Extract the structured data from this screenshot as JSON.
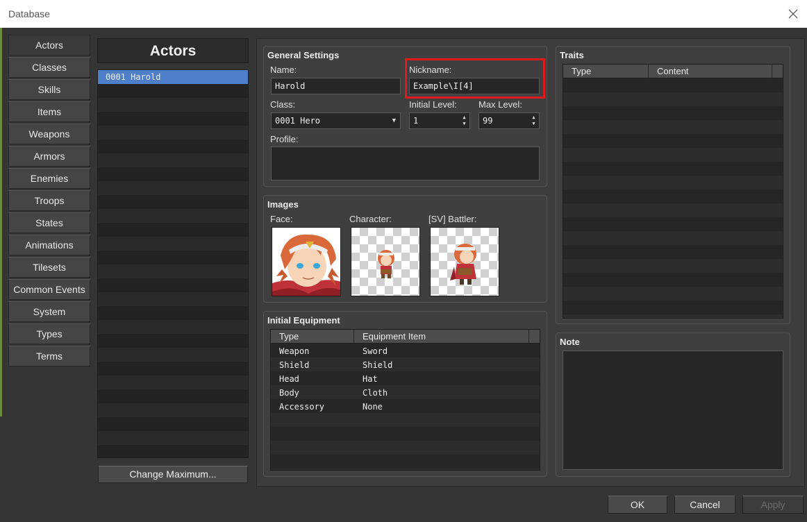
{
  "window": {
    "title": "Database"
  },
  "categories": [
    {
      "label": "Actors"
    },
    {
      "label": "Classes"
    },
    {
      "label": "Skills"
    },
    {
      "label": "Items"
    },
    {
      "label": "Weapons"
    },
    {
      "label": "Armors"
    },
    {
      "label": "Enemies"
    },
    {
      "label": "Troops"
    },
    {
      "label": "States"
    },
    {
      "label": "Animations"
    },
    {
      "label": "Tilesets"
    },
    {
      "label": "Common Events"
    },
    {
      "label": "System"
    },
    {
      "label": "Types"
    },
    {
      "label": "Terms"
    }
  ],
  "actors_panel": {
    "title": "Actors",
    "items": [
      {
        "label": "0001 Harold"
      }
    ],
    "change_max_label": "Change Maximum..."
  },
  "general": {
    "title": "General Settings",
    "name_label": "Name:",
    "name_value": "Harold",
    "nickname_label": "Nickname:",
    "nickname_value": "Example\\I[4]",
    "class_label": "Class:",
    "class_value": "0001 Hero",
    "initial_level_label": "Initial Level:",
    "initial_level_value": "1",
    "max_level_label": "Max Level:",
    "max_level_value": "99",
    "profile_label": "Profile:"
  },
  "images": {
    "title": "Images",
    "face_label": "Face:",
    "character_label": "Character:",
    "battler_label": "[SV] Battler:"
  },
  "equipment": {
    "title": "Initial Equipment",
    "columns": [
      "Type",
      "Equipment Item"
    ],
    "rows": [
      {
        "type": "Weapon",
        "item": "Sword"
      },
      {
        "type": "Shield",
        "item": "Shield"
      },
      {
        "type": "Head",
        "item": "Hat"
      },
      {
        "type": "Body",
        "item": "Cloth"
      },
      {
        "type": "Accessory",
        "item": "None"
      }
    ]
  },
  "traits": {
    "title": "Traits",
    "columns": [
      "Type",
      "Content"
    ]
  },
  "note": {
    "title": "Note"
  },
  "footer": {
    "ok": "OK",
    "cancel": "Cancel",
    "apply": "Apply"
  },
  "colors": {
    "selection": "#4f7fc8",
    "highlight_border": "#e01b1b"
  }
}
